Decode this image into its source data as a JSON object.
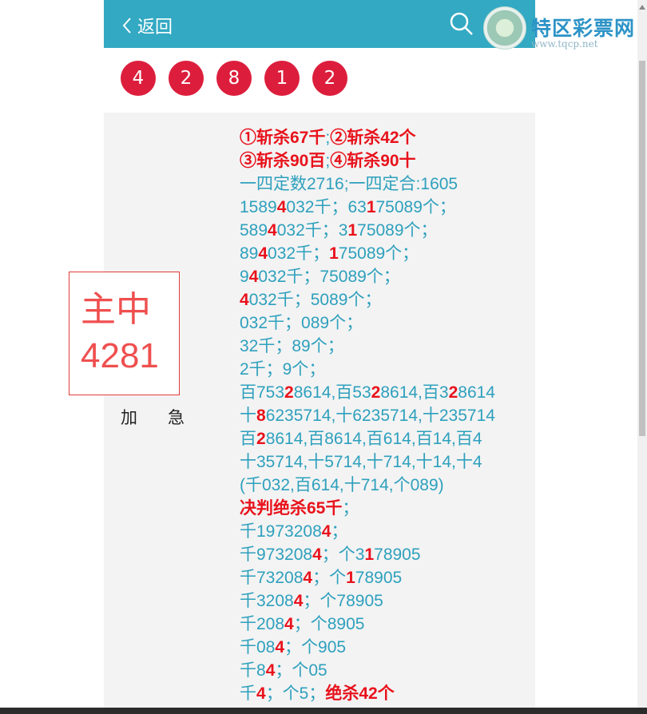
{
  "header": {
    "back_label": "返回",
    "logo_text": "特区彩票网",
    "logo_url": "www.tqcp.net",
    "bg_color": "#33a9c3"
  },
  "balls": [
    "4",
    "2",
    "8",
    "1",
    "2"
  ],
  "stamp": {
    "line1": "主中",
    "line2": "4281",
    "color": "#ef4f4f"
  },
  "urgent_label": "加急",
  "prediction_lines": [
    [
      {
        "t": "①斩杀67千",
        "h": true
      },
      {
        "t": ";"
      },
      {
        "t": "②斩杀42个",
        "h": true
      }
    ],
    [
      {
        "t": "③斩杀90百",
        "h": true
      },
      {
        "t": ";"
      },
      {
        "t": "④斩杀90十",
        "h": true
      }
    ],
    [
      {
        "t": "一四定数2716;一四定合:1605"
      }
    ],
    [
      {
        "t": "1589"
      },
      {
        "t": "4",
        "h": true
      },
      {
        "t": "032千；63"
      },
      {
        "t": "1",
        "h": true
      },
      {
        "t": "75089个；"
      }
    ],
    [
      {
        "t": "589"
      },
      {
        "t": "4",
        "h": true
      },
      {
        "t": "032千；3"
      },
      {
        "t": "1",
        "h": true
      },
      {
        "t": "75089个；"
      }
    ],
    [
      {
        "t": "89"
      },
      {
        "t": "4",
        "h": true
      },
      {
        "t": "032千；"
      },
      {
        "t": "1",
        "h": true
      },
      {
        "t": "75089个；"
      }
    ],
    [
      {
        "t": "9"
      },
      {
        "t": "4",
        "h": true
      },
      {
        "t": "032千；75089个；"
      }
    ],
    [
      {
        "t": "4",
        "h": true
      },
      {
        "t": "032千；5089个；"
      }
    ],
    [
      {
        "t": "032千；089个；"
      }
    ],
    [
      {
        "t": "32千；89个；"
      }
    ],
    [
      {
        "t": "2千；9个；"
      }
    ],
    [
      {
        "t": "百753"
      },
      {
        "t": "2",
        "h": true
      },
      {
        "t": "8614,百53"
      },
      {
        "t": "2",
        "h": true
      },
      {
        "t": "8614,百3"
      },
      {
        "t": "2",
        "h": true
      },
      {
        "t": "8614"
      }
    ],
    [
      {
        "t": "十"
      },
      {
        "t": "8",
        "h": true
      },
      {
        "t": "6235714,十6235714,十235714"
      }
    ],
    [
      {
        "t": "百"
      },
      {
        "t": "2",
        "h": true
      },
      {
        "t": "8614,百8614,百614,百14,百4"
      }
    ],
    [
      {
        "t": "十35714,十5714,十714,十14,十4"
      }
    ],
    [
      {
        "t": "(千032,百614,十714,个089)"
      }
    ],
    [
      {
        "t": "决判绝杀65千",
        "h": true
      },
      {
        "t": "；"
      }
    ],
    [
      {
        "t": "千1973208"
      },
      {
        "t": "4",
        "h": true
      },
      {
        "t": "；"
      }
    ],
    [
      {
        "t": "千973208"
      },
      {
        "t": "4",
        "h": true
      },
      {
        "t": "；个3"
      },
      {
        "t": "1",
        "h": true
      },
      {
        "t": "78905"
      }
    ],
    [
      {
        "t": "千73208"
      },
      {
        "t": "4",
        "h": true
      },
      {
        "t": "；个"
      },
      {
        "t": "1",
        "h": true
      },
      {
        "t": "78905"
      }
    ],
    [
      {
        "t": "千3208"
      },
      {
        "t": "4",
        "h": true
      },
      {
        "t": "；个78905"
      }
    ],
    [
      {
        "t": "千208"
      },
      {
        "t": "4",
        "h": true
      },
      {
        "t": "；个8905"
      }
    ],
    [
      {
        "t": "千08"
      },
      {
        "t": "4",
        "h": true
      },
      {
        "t": "；个905"
      }
    ],
    [
      {
        "t": "千8"
      },
      {
        "t": "4",
        "h": true
      },
      {
        "t": "；个05"
      }
    ],
    [
      {
        "t": "千"
      },
      {
        "t": "4",
        "h": true
      },
      {
        "t": "；个5；"
      },
      {
        "t": "绝杀42个",
        "h": true
      }
    ]
  ],
  "colors": {
    "highlight": "#e8121c",
    "text": "#2ea0bd",
    "ball": "#dc1e3c"
  }
}
